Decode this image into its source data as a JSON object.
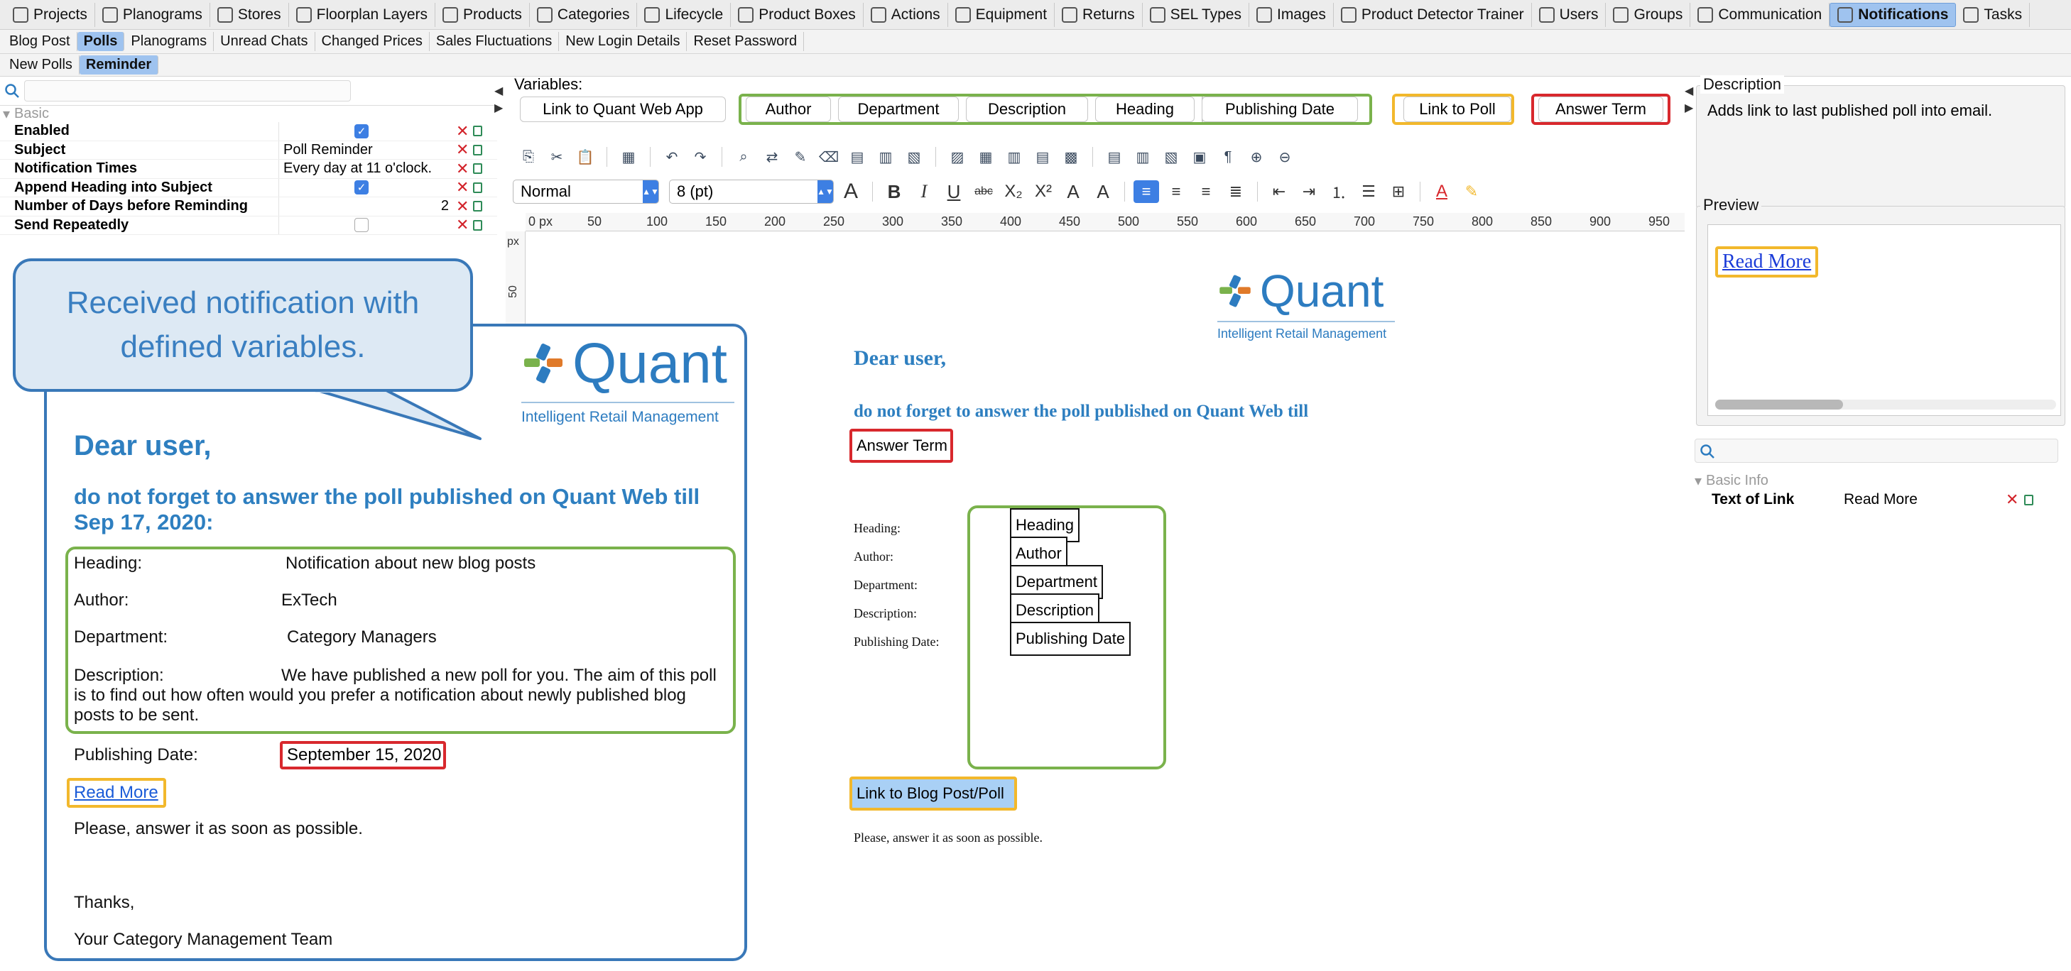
{
  "menu": {
    "items": [
      {
        "label": "Projects",
        "icon": "projects-icon"
      },
      {
        "label": "Planograms",
        "icon": "planograms-icon"
      },
      {
        "label": "Stores",
        "icon": "stores-icon"
      },
      {
        "label": "Floorplan Layers",
        "icon": "floorplan-layers-icon"
      },
      {
        "label": "Products",
        "icon": "products-icon"
      },
      {
        "label": "Categories",
        "icon": "categories-icon"
      },
      {
        "label": "Lifecycle",
        "icon": "lifecycle-icon"
      },
      {
        "label": "Product Boxes",
        "icon": "product-boxes-icon"
      },
      {
        "label": "Actions",
        "icon": "actions-icon"
      },
      {
        "label": "Equipment",
        "icon": "equipment-icon"
      },
      {
        "label": "Returns",
        "icon": "returns-icon"
      },
      {
        "label": "SEL Types",
        "icon": "sel-types-icon"
      },
      {
        "label": "Images",
        "icon": "images-icon"
      },
      {
        "label": "Product Detector Trainer",
        "icon": "product-detector-trainer-icon"
      },
      {
        "label": "Users",
        "icon": "users-icon"
      },
      {
        "label": "Groups",
        "icon": "groups-icon"
      },
      {
        "label": "Communication",
        "icon": "communication-icon"
      },
      {
        "label": "Notifications",
        "icon": "notifications-icon",
        "active": true
      },
      {
        "label": "Tasks",
        "icon": "tasks-icon"
      }
    ]
  },
  "subtabs": [
    "Blog Post",
    "Polls",
    "Planograms",
    "Unread Chats",
    "Changed Prices",
    "Sales Fluctuations",
    "New Login Details",
    "Reset Password"
  ],
  "subtabs2": [
    "New Polls",
    "Reminder"
  ],
  "properties": {
    "group": "Basic",
    "rows": [
      {
        "name": "Enabled",
        "value": "",
        "checkbox": "checked"
      },
      {
        "name": "Subject",
        "value": "Poll Reminder"
      },
      {
        "name": "Notification Times",
        "value": "Every day at 11 o'clock."
      },
      {
        "name": "Append Heading into Subject",
        "value": "",
        "checkbox": "checked"
      },
      {
        "name": "Number of Days before Reminding",
        "value": "2"
      },
      {
        "name": "Send Repeatedly",
        "value": "",
        "checkbox": "unchecked"
      }
    ]
  },
  "bubble": {
    "text": "Received notification with defined variables."
  },
  "email": {
    "logo_word": "Quant",
    "logo_sub": "Intelligent Retail Management",
    "greeting": "Dear user,",
    "line": "do not forget to answer the poll published on Quant Web till Sep 17, 2020:",
    "rows": [
      {
        "label": "Heading:",
        "value": "Notification about new blog posts"
      },
      {
        "label": "Author:",
        "value": "ExTech"
      },
      {
        "label": "Department:",
        "value": "Category Managers"
      },
      {
        "label": "Description:",
        "value": "We have published a new poll for you. The aim of this poll is to find out how often would you prefer a notification about newly published blog posts to be sent."
      }
    ],
    "pub_label": "Publishing Date:",
    "pub_value": "September 15, 2020",
    "read_more": "Read More",
    "closing": "Please, answer it as soon as possible.",
    "thanks": "Thanks,",
    "team": "Your Category Management Team"
  },
  "variables": {
    "title": "Variables:",
    "buttons": [
      "Link to Quant Web App",
      "Author",
      "Department",
      "Description",
      "Heading",
      "Publishing Date",
      "Link to Poll",
      "Answer Term"
    ]
  },
  "format": {
    "style": "Normal",
    "size": "8 (pt)"
  },
  "ruler": {
    "unit": "px",
    "ticks": [
      "0 px",
      "50",
      "100",
      "150",
      "200",
      "250",
      "300",
      "350",
      "400",
      "450",
      "500",
      "550",
      "600",
      "650",
      "700",
      "750",
      "800",
      "850",
      "900",
      "950"
    ],
    "v_ticks": [
      "px",
      "50"
    ]
  },
  "document": {
    "logo_word": "Quant",
    "logo_sub": "Intelligent Retail Management",
    "greeting": "Dear user,",
    "line": "do not forget to answer the poll published on Quant Web till",
    "answer_term": "Answer Term",
    "fields": [
      {
        "label": "Heading:",
        "value": "Heading"
      },
      {
        "label": "Author:",
        "value": "Author"
      },
      {
        "label": "Department:",
        "value": "Department"
      },
      {
        "label": "Description:",
        "value": "Description"
      },
      {
        "label": "Publishing Date:",
        "value": "Publishing Date"
      }
    ],
    "link": "Link to Blog Post/Poll",
    "note": "Please, answer it as soon as possible."
  },
  "description": {
    "title": "Description",
    "text": "Adds link to last published poll into email."
  },
  "preview": {
    "title": "Preview",
    "read_more": "Read More"
  },
  "basic_info": {
    "group": "Basic Info",
    "name": "Text of Link",
    "value": "Read More"
  },
  "colors": {
    "green": "#7ab24c",
    "yellow": "#f2b82c",
    "red": "#d8282d",
    "blue": "#3978b8",
    "accent": "#3d7fe3"
  }
}
